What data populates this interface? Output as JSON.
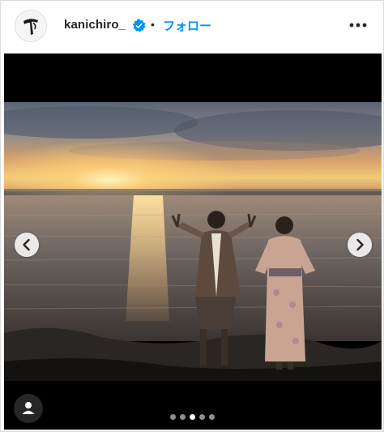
{
  "post": {
    "username": "kanichiro_",
    "separator": "•",
    "follow_label": "フォロー",
    "verified": true,
    "accent_color": "#0095f6",
    "verified_color": "#0095f6"
  },
  "icons": {
    "verified": "verified-badge-icon",
    "more": "more-options-icon",
    "prev": "chevron-left-icon",
    "next": "chevron-right-icon",
    "user_tag": "user-tag-icon"
  },
  "carousel": {
    "total_slides": 5,
    "active_index": 2
  }
}
